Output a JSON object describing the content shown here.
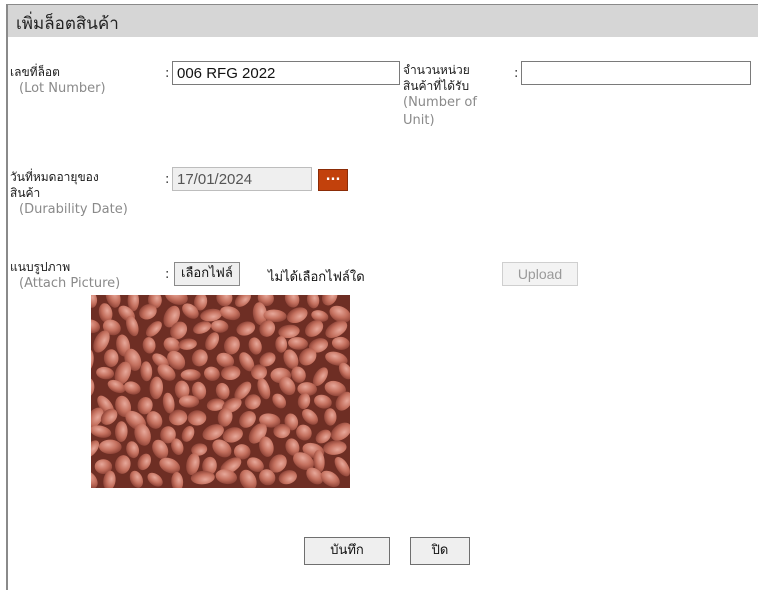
{
  "header": {
    "title": "เพิ่มล็อตสินค้า"
  },
  "form": {
    "lot_number": {
      "label_th": "เลขที่ล็อต",
      "label_en": "(Lot Number)",
      "colon": ":",
      "value": "006 RFG 2022"
    },
    "unit_count": {
      "label_th_1": "จำนวนหน่วย",
      "label_th_2": "สินค้าที่ได้รับ",
      "label_en_1": "(Number of",
      "label_en_2": "Unit)",
      "colon": ":",
      "value": ""
    },
    "durability_date": {
      "label_th_1": "วันที่หมดอายุของ",
      "label_th_2": "สินค้า",
      "label_en": "(Durability Date)",
      "colon": ":",
      "value": "17/01/2024",
      "picker_label": "..."
    },
    "attach_picture": {
      "label_th": "แนบรูปภาพ",
      "label_en": "(Attach Picture)",
      "colon": ":",
      "choose_file_label": "เลือกไฟล์",
      "no_file_text": "ไม่ได้เลือกไฟล์ใด",
      "upload_label": "Upload",
      "preview_image": "peanuts-photo"
    }
  },
  "actions": {
    "save_label": "บันทึก",
    "close_label": "ปิด"
  },
  "colors": {
    "picker_button": "#c2410c",
    "title_bar": "#d6d6d6",
    "sub_label": "#8a8a8a"
  }
}
